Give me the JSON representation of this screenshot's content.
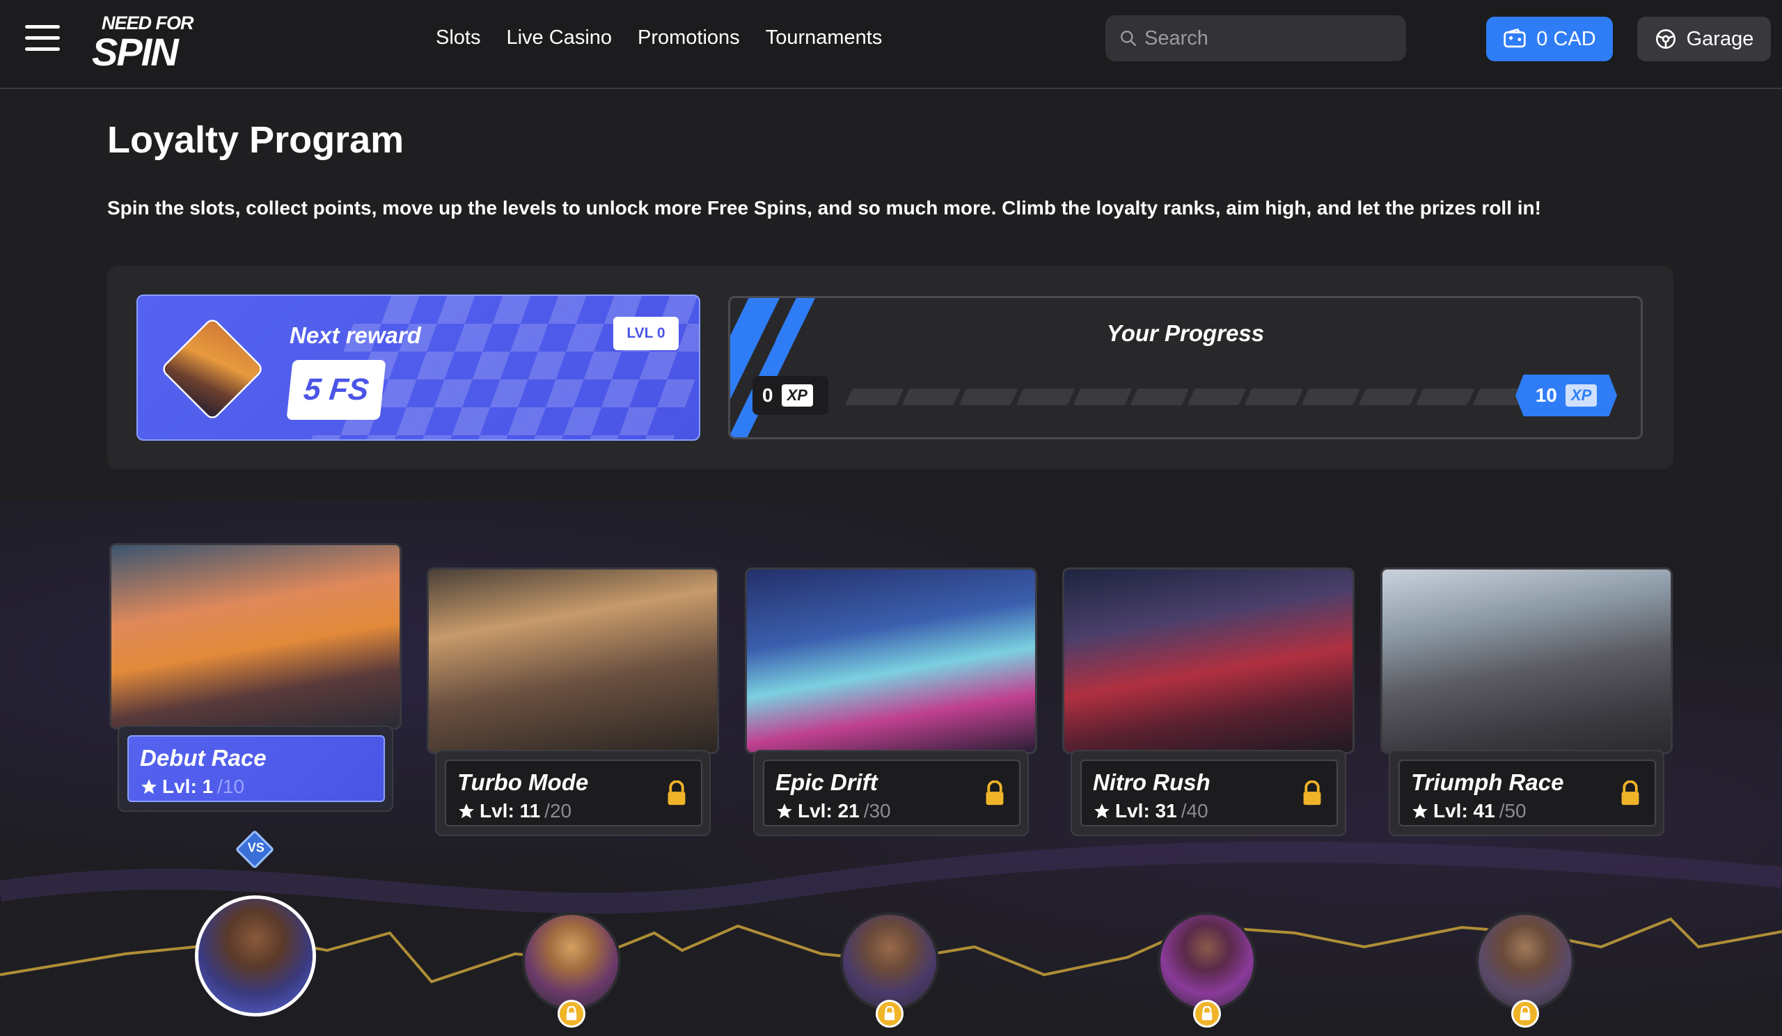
{
  "header": {
    "logo_line1": "NEED FOR",
    "logo_line2": "SPIN",
    "nav": [
      "Slots",
      "Live Casino",
      "Promotions",
      "Tournaments"
    ],
    "search_placeholder": "Search",
    "wallet": "0 CAD",
    "garage": "Garage"
  },
  "page": {
    "title": "Loyalty Program",
    "description": "Spin the slots, collect points, move up the levels to unlock more Free Spins, and so much more. Climb the loyalty ranks, aim high, and let the prizes roll in!"
  },
  "next_reward": {
    "title": "Next reward",
    "reward": "5 FS",
    "level_badge": "LVL 0"
  },
  "progress": {
    "title": "Your Progress",
    "start_value": "0",
    "end_value": "10",
    "xp_label": "XP",
    "fraction": 0
  },
  "levels": [
    {
      "name": "Debut Race",
      "lvl_prefix": "Lvl: 1",
      "lvl_max": "/10",
      "locked": false
    },
    {
      "name": "Turbo Mode",
      "lvl_prefix": "Lvl: 11",
      "lvl_max": "/20",
      "locked": true
    },
    {
      "name": "Epic Drift",
      "lvl_prefix": "Lvl: 21",
      "lvl_max": "/30",
      "locked": true
    },
    {
      "name": "Nitro Rush",
      "lvl_prefix": "Lvl: 31",
      "lvl_max": "/40",
      "locked": true
    },
    {
      "name": "Triumph Race",
      "lvl_prefix": "Lvl: 41",
      "lvl_max": "/50",
      "locked": true
    }
  ],
  "vs_label": "VS",
  "colors": {
    "accent_blue": "#2f7df6",
    "reward_purple": "#4a55e6",
    "lock_gold": "#f0b429",
    "background": "#1f1f21"
  }
}
